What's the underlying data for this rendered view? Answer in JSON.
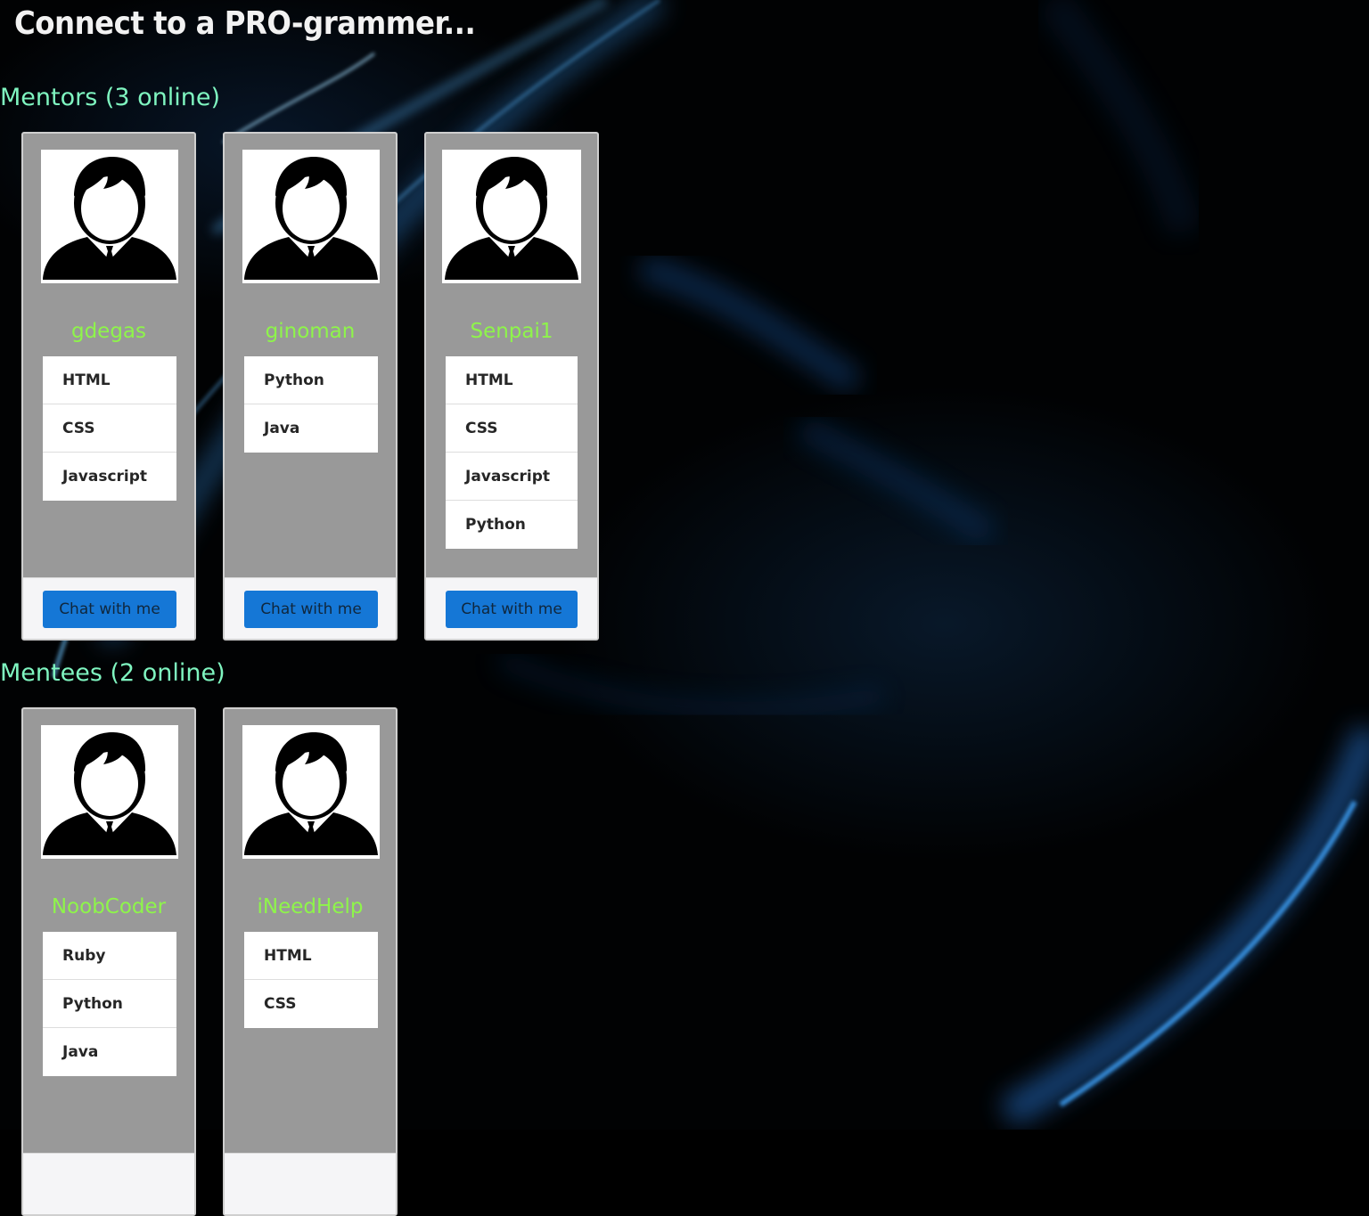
{
  "page": {
    "title": "Connect to a PRO-grammer..."
  },
  "mentors": {
    "heading": "Mentors (3 online)",
    "cards": [
      {
        "name": "gdegas",
        "skills": [
          "HTML",
          "CSS",
          "Javascript"
        ],
        "button_label": "Chat with me"
      },
      {
        "name": "ginoman",
        "skills": [
          "Python",
          "Java"
        ],
        "button_label": "Chat with me"
      },
      {
        "name": "Senpai1",
        "skills": [
          "HTML",
          "CSS",
          "Javascript",
          "Python"
        ],
        "button_label": "Chat with me"
      }
    ]
  },
  "mentees": {
    "heading": "Mentees (2 online)",
    "cards": [
      {
        "name": "NoobCoder",
        "skills": [
          "Ruby",
          "Python",
          "Java"
        ]
      },
      {
        "name": "iNeedHelp",
        "skills": [
          "HTML",
          "CSS"
        ]
      }
    ]
  },
  "icons": {
    "avatar": "user-avatar-icon"
  },
  "colors": {
    "title": "#f2f2f2",
    "section_heading": "#7ff5c0",
    "card_name": "#8ef54a",
    "card_background": "#999999",
    "button": "#1577d6",
    "button_text": "#10273d"
  }
}
